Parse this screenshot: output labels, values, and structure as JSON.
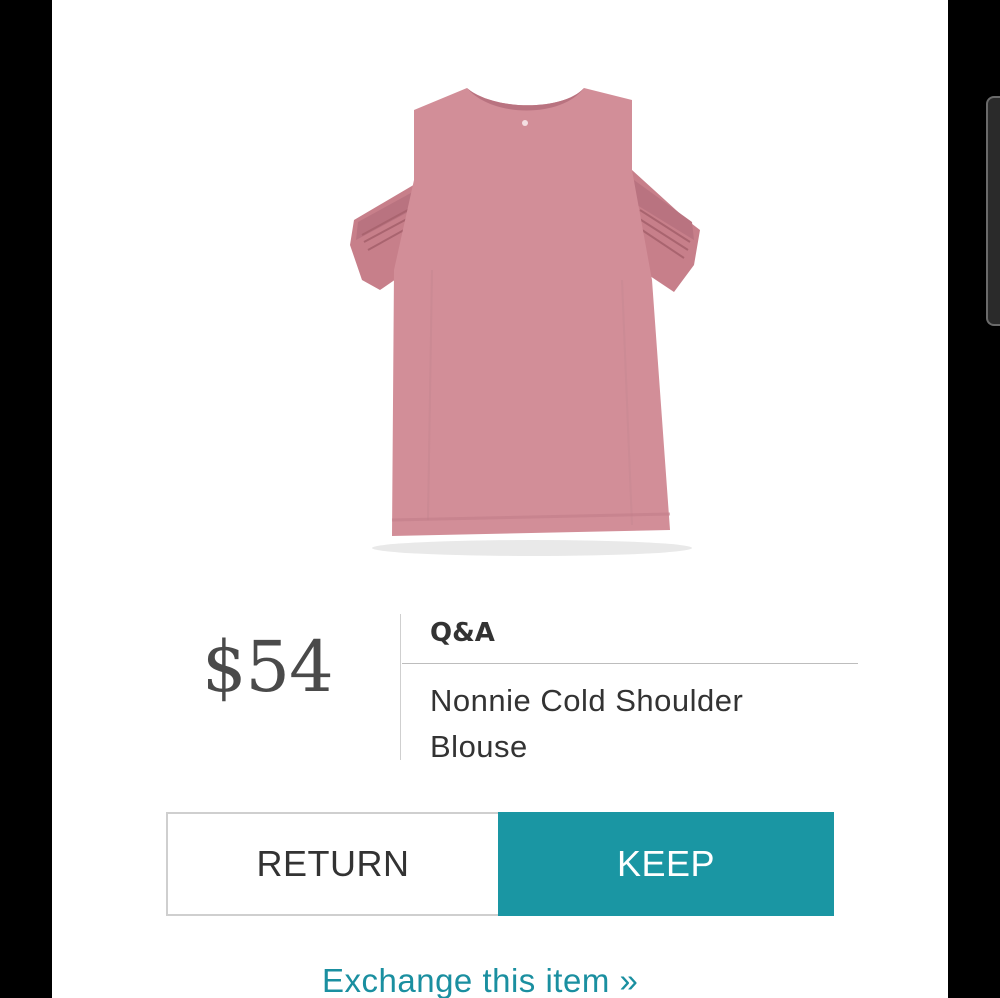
{
  "product": {
    "price": "$54",
    "brand": "Q&A",
    "name": "Nonnie Cold Shoulder Blouse",
    "image_icon": "blouse-image",
    "garment_color": "#d28e98"
  },
  "actions": {
    "return_label": "RETURN",
    "keep_label": "KEEP",
    "keep_color": "#1a96a3"
  },
  "links": {
    "exchange_label": "Exchange this item »",
    "link_color": "#1a8fa0"
  }
}
